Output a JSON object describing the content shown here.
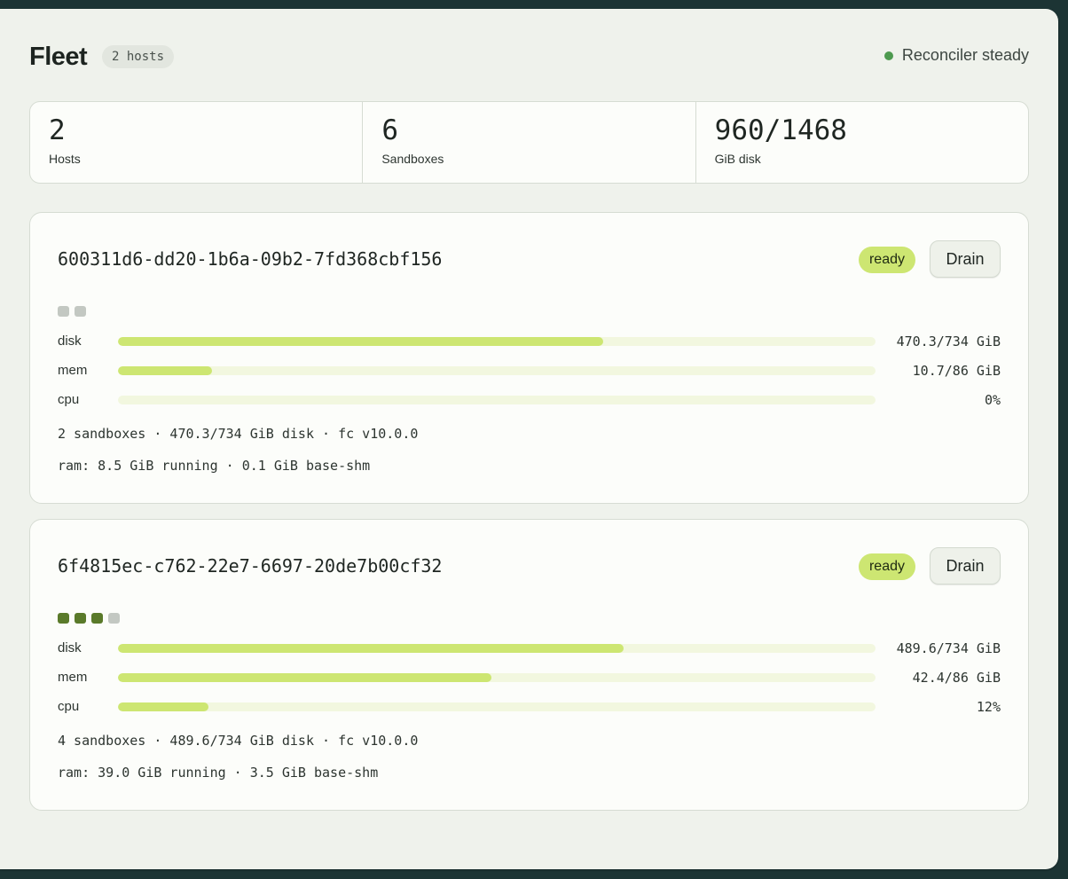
{
  "header": {
    "title": "Fleet",
    "count_badge": "2 hosts",
    "status_text": "Reconciler steady",
    "status_color": "#4d9a4f"
  },
  "stats": [
    {
      "value": "2",
      "label": "Hosts"
    },
    {
      "value": "6",
      "label": "Sandboxes"
    },
    {
      "value": "960/1468",
      "label": "GiB disk"
    }
  ],
  "hosts": [
    {
      "id": "600311d6-dd20-1b6a-09b2-7fd368cbf156",
      "status": "ready",
      "drain_label": "Drain",
      "slots": {
        "used": 0,
        "total": 2
      },
      "meters": [
        {
          "label": "disk",
          "value": "470.3/734 GiB",
          "fraction": 0.641
        },
        {
          "label": "mem",
          "value": "10.7/86 GiB",
          "fraction": 0.124
        },
        {
          "label": "cpu",
          "value": "0%",
          "fraction": 0.0
        }
      ],
      "summary": "2 sandboxes · 470.3/734 GiB disk · fc v10.0.0",
      "ram": "ram: 8.5 GiB running · 0.1 GiB base-shm"
    },
    {
      "id": "6f4815ec-c762-22e7-6697-20de7b00cf32",
      "status": "ready",
      "drain_label": "Drain",
      "slots": {
        "used": 3,
        "total": 4
      },
      "meters": [
        {
          "label": "disk",
          "value": "489.6/734 GiB",
          "fraction": 0.667
        },
        {
          "label": "mem",
          "value": "42.4/86 GiB",
          "fraction": 0.493
        },
        {
          "label": "cpu",
          "value": "12%",
          "fraction": 0.12
        }
      ],
      "summary": "4 sandboxes · 489.6/734 GiB disk · fc v10.0.0",
      "ram": "ram: 39.0 GiB running · 3.5 GiB base-shm"
    }
  ],
  "colors": {
    "accent_fill": "#cde672",
    "track": "#f2f7df",
    "slot_used": "#5a7a2a",
    "slot_free": "#c3c8c2"
  }
}
